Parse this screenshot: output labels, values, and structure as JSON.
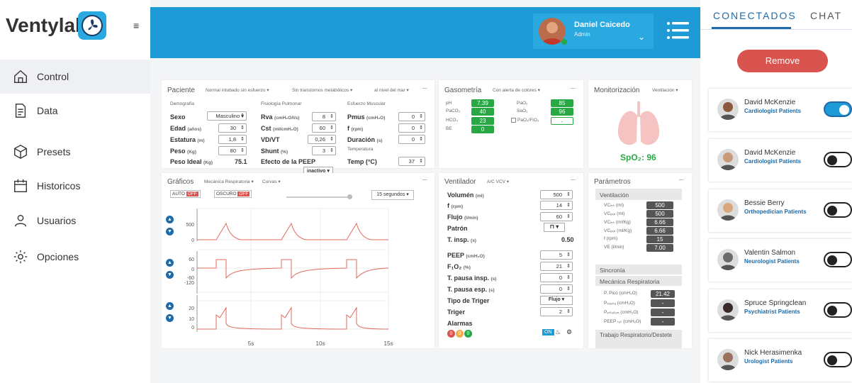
{
  "app": {
    "logo": "Ventylab"
  },
  "nav": [
    {
      "label": "Control"
    },
    {
      "label": "Data"
    },
    {
      "label": "Presets"
    },
    {
      "label": "Historicos"
    },
    {
      "label": "Usuarios"
    },
    {
      "label": "Opciones"
    }
  ],
  "user": {
    "name": "Daniel Caicedo",
    "role": "Admin"
  },
  "paciente": {
    "title": "Paciente",
    "filters": [
      "Normal intubado sin esfuerzo ▾",
      "Sin transtornos metabólicos ▾",
      "al nivel del mar ▾"
    ],
    "demo_h": "Demografía",
    "fis_h": "Fisiología Pulmonar",
    "esf_h": "Esfuerzo Muscular",
    "temp_h": "Temperatura",
    "sexo_l": "Sexo",
    "sexo_v": "Masculino ▾",
    "edad_l": "Edad",
    "edad_u": "(años)",
    "edad_v": "30",
    "est_l": "Estatura",
    "est_u": "(m)",
    "est_v": "1,8",
    "peso_l": "Peso",
    "peso_u": "(Kg)",
    "peso_v": "80",
    "pi_l": "Peso Ideal",
    "pi_u": "(Kg)",
    "pi_v": "75.1",
    "rva_l": "Rva",
    "rva_u": "(cmH₂O/l/s)",
    "rva_v": "8",
    "cst_l": "Cst",
    "cst_u": "(ml/cmH₂O)",
    "cst_v": "60",
    "vdvt_l": "VD/VT",
    "vdvt_v": "0,26",
    "shunt_l": "Shunt",
    "shunt_u": "(%)",
    "shunt_v": "3",
    "peep_e": "Efecto de la PEEP",
    "peep_e_v": "inactivo ▾",
    "pmus_l": "Pmus",
    "pmus_u": "(cmH₂O)",
    "pmus_v": "0",
    "f_l": "f",
    "f_u": "(rpm)",
    "f_v": "0",
    "dur_l": "Duración",
    "dur_u": "(s)",
    "dur_v": "0",
    "temp_l": "Temp (°C)",
    "temp_v": "37"
  },
  "gaso": {
    "title": "Gasometría",
    "filter": "Con alerta de colores ▾",
    "ph_l": "pH",
    "ph": "7.39",
    "paco2_l": "PaCO₂",
    "paco2": "40",
    "hco3_l": "HCO₃",
    "hco3": "23",
    "be_l": "BE",
    "be": "0",
    "pao2_l": "PaO₂",
    "pao2": "85",
    "sao2_l": "SaO₂",
    "sao2": "96",
    "pf_l": "PaO₂/FiO₂",
    "pf": "-"
  },
  "monit": {
    "title": "Monitorización",
    "filter": "Ventilación ▾",
    "spo2_l": "SpO₂: ",
    "spo2": "96"
  },
  "graf": {
    "title": "Gráficos",
    "f1": "Mecánica Respiratoria ▾",
    "f2": "Curvas ▾",
    "auto": "AUTO",
    "oscuro": "OSCURO",
    "off": "OFF",
    "time": "15 segundos ▾",
    "ax1": [
      "500",
      "0"
    ],
    "ax2": [
      "60",
      "0",
      "-60",
      "-120"
    ],
    "ax3": [
      "20",
      "10",
      "0"
    ],
    "xt": [
      "5s",
      "10s",
      "15s"
    ]
  },
  "vent": {
    "title": "Ventilador",
    "mode": "A/C VCV ▾",
    "rows": [
      {
        "l": "Volumén",
        "u": "(ml)",
        "v": "500"
      },
      {
        "l": "f",
        "u": "(rpm)",
        "v": "14"
      },
      {
        "l": "Flujo",
        "u": "(l/min)",
        "v": "60"
      },
      {
        "l": "Patrón",
        "u": "",
        "v": "⊓ ▾"
      },
      {
        "l": "T. insp.",
        "u": "(s)",
        "v": "0.50"
      },
      {
        "l": "PEEP",
        "u": "(cmH₂O)",
        "v": "5"
      },
      {
        "l": "F₁O₂",
        "u": "(%)",
        "v": "21"
      },
      {
        "l": "T. pausa insp.",
        "u": "(s)",
        "v": "0"
      },
      {
        "l": "T. pausa esp.",
        "u": "(s)",
        "v": "0"
      },
      {
        "l": "Tipo de Triger",
        "u": "",
        "v": "Flujo ▾"
      },
      {
        "l": "Triger",
        "u": "",
        "v": "2"
      },
      {
        "l": "Alarmas",
        "u": "",
        "v": ""
      }
    ],
    "alarms": [
      "0",
      "0",
      "0"
    ],
    "on": "ON"
  },
  "param": {
    "title": "Parámetros",
    "vent_h": "Ventilación",
    "vrows": [
      {
        "l": "VCᵢₙₛ (ml)",
        "v": "500"
      },
      {
        "l": "VCₑₓₚ (ml)",
        "v": "500"
      },
      {
        "l": "VCᵢₙₛ (ml/Kg)",
        "v": "6.66"
      },
      {
        "l": "VCₑₓₚ (ml/Kg)",
        "v": "6.66"
      },
      {
        "l": "f (rpm)",
        "v": "15"
      },
      {
        "l": "VE (l/min)",
        "v": "7.00"
      }
    ],
    "sinc_h": "Sincronía",
    "mec_h": "Mecánica Respiratoria",
    "mrows": [
      {
        "l": "P. Pico (cmH₂O)",
        "v": "21.42"
      },
      {
        "l": "Pₚₐᵤₛₐ (cmH₂O)",
        "v": "-"
      },
      {
        "l": "Pₑₛₜₐₜᵢₒₙ (cmH₂O)",
        "v": "-"
      },
      {
        "l": "PEEP ₜₒₜ (cmH₂O)",
        "v": "-"
      }
    ],
    "trab_h": "Trabajo Respiratorio/Destete"
  },
  "right": {
    "tab1": "CONECTADOS",
    "tab2": "CHAT",
    "remove": "Remove",
    "contacts": [
      {
        "name": "David McKenzie",
        "role": "Cardiologist Patients",
        "on": true
      },
      {
        "name": "David McKenzie",
        "role": "Cardiologist Patients",
        "on": false
      },
      {
        "name": "Bessie Berry",
        "role": "Orthopedician Patients",
        "on": false
      },
      {
        "name": "Valentin Salmon",
        "role": "Neurologist Patients",
        "on": false
      },
      {
        "name": "Spruce Springclean",
        "role": "Psychiatrist Patients",
        "on": false
      },
      {
        "name": "Nick Herasimenka",
        "role": "Urologist Patients",
        "on": false
      }
    ]
  },
  "colors": {
    "accent": "#1e9ad6",
    "ok": "#28a745",
    "danger": "#d9534f",
    "wave": "#e06b5e"
  }
}
